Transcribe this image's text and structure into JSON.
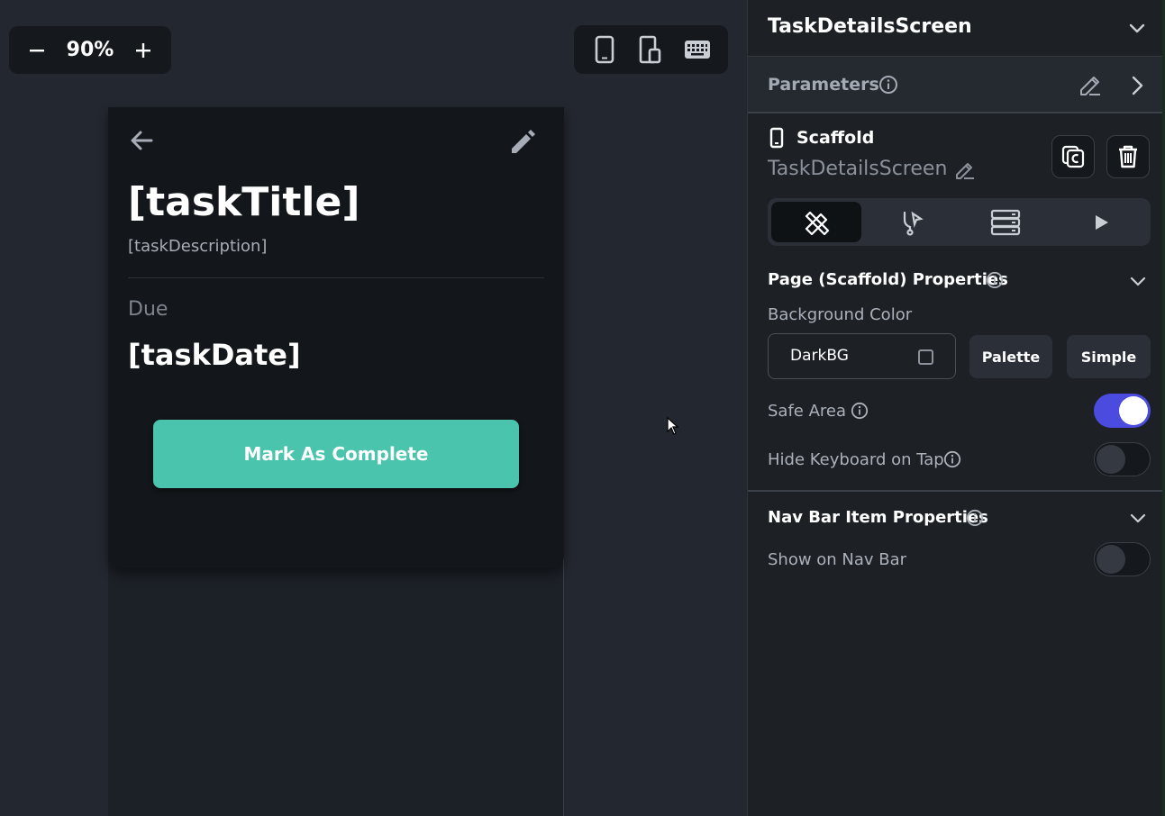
{
  "canvas": {
    "zoom": {
      "value": "90%",
      "decrease": "−",
      "increase": "+"
    }
  },
  "preview": {
    "task_title": "[taskTitle]",
    "task_description": "[taskDescription]",
    "due_label": "Due",
    "task_date": "[taskDate]",
    "complete_button": "Mark As Complete",
    "button_color": "#4ac4ad"
  },
  "panel": {
    "screen_name": "TaskDetailsScreen",
    "parameters_label": "Parameters",
    "widget_type": "Scaffold",
    "widget_name": "TaskDetailsScreen",
    "page_properties_title": "Page (Scaffold) Properties",
    "background_color_label": "Background Color",
    "background_color_value": "DarkBG",
    "palette_button": "Palette",
    "simple_button": "Simple",
    "safe_area_label": "Safe Area",
    "safe_area_on": true,
    "hide_keyboard_label": "Hide Keyboard on Tap",
    "hide_keyboard_on": false,
    "nav_bar_title": "Nav Bar Item Properties",
    "show_nav_bar_label": "Show on Nav Bar",
    "show_nav_bar_on": false,
    "accent_color": "#4b4be0"
  }
}
